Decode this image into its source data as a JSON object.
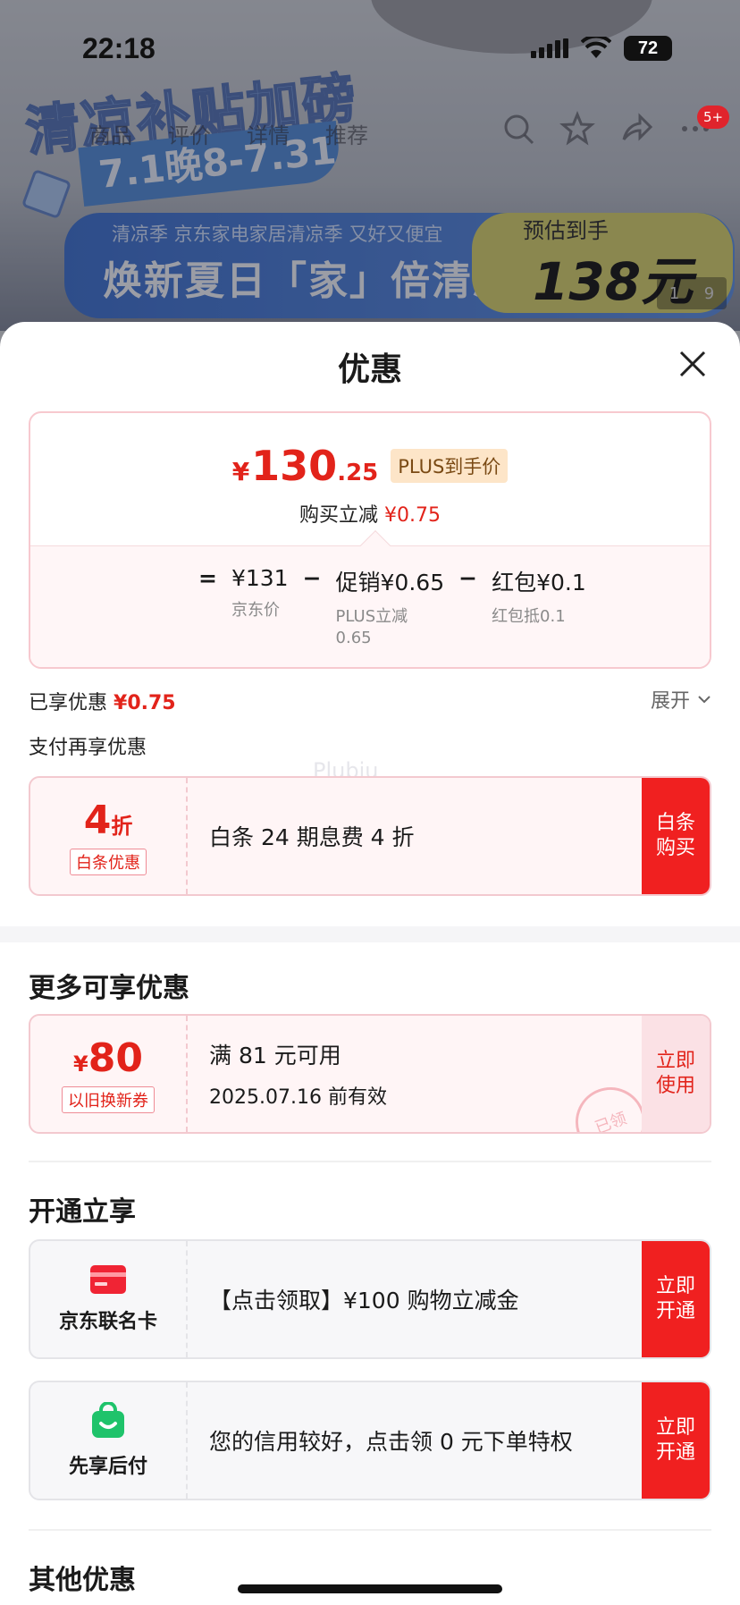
{
  "status_bar": {
    "time": "22:18",
    "battery": "72"
  },
  "banner": {
    "title": "清凉补贴加磅",
    "date": "7.1晚8-7.31",
    "sub": "清凉季  京东家电家居清凉季 又好又便宜",
    "main": "焕新夏日「家」倍清凉",
    "estimate_label": "预估到手",
    "estimate_price": "138元",
    "page_current": "1",
    "page_total": "9"
  },
  "nav": {
    "tabs": [
      "商品",
      "评价",
      "详情",
      "推荐"
    ],
    "message_badge": "5+"
  },
  "sheet": {
    "title": "优惠",
    "price": {
      "yen": "¥",
      "integer": "130",
      "decimal": ".25",
      "plus_tag": "PLUS到手价",
      "reduce_label": "购买立减",
      "reduce_value": "¥0.75"
    },
    "formula": {
      "eq": "=",
      "base": "¥131",
      "base_label": "京东价",
      "minus": "−",
      "promo": "促销¥0.65",
      "promo_label": "PLUS立减\n0.65",
      "redpacket": "红包¥0.1",
      "redpacket_label": "红包抵0.1"
    },
    "enjoyed_label": "已享优惠",
    "enjoyed_value": "¥0.75",
    "expand_label": "展开",
    "pay_more_label": "支付再享优惠",
    "watermark": "Plubiu",
    "baitiao": {
      "discount_num": "4",
      "discount_unit": "折",
      "tag": "白条优惠",
      "desc": "白条 24 期息费 4 折",
      "action": "白条购买"
    },
    "more_title": "更多可享优惠",
    "coupon": {
      "yen": "¥",
      "amount": "80",
      "tag": "以旧换新券",
      "condition": "满 81 元可用",
      "expiry": "2025.07.16 前有效",
      "action": "立即使用",
      "stamp": "已领"
    },
    "open_title": "开通立享",
    "card1": {
      "caption": "京东联名卡",
      "desc": "【点击领取】¥100 购物立减金",
      "action": "立即开通"
    },
    "card2": {
      "caption": "先享后付",
      "desc": "您的信用较好，点击领 0 元下单特权",
      "action": "立即开通"
    },
    "other_title": "其他优惠"
  },
  "colors": {
    "accent_red": "#e2231a",
    "button_red": "#f02020"
  }
}
